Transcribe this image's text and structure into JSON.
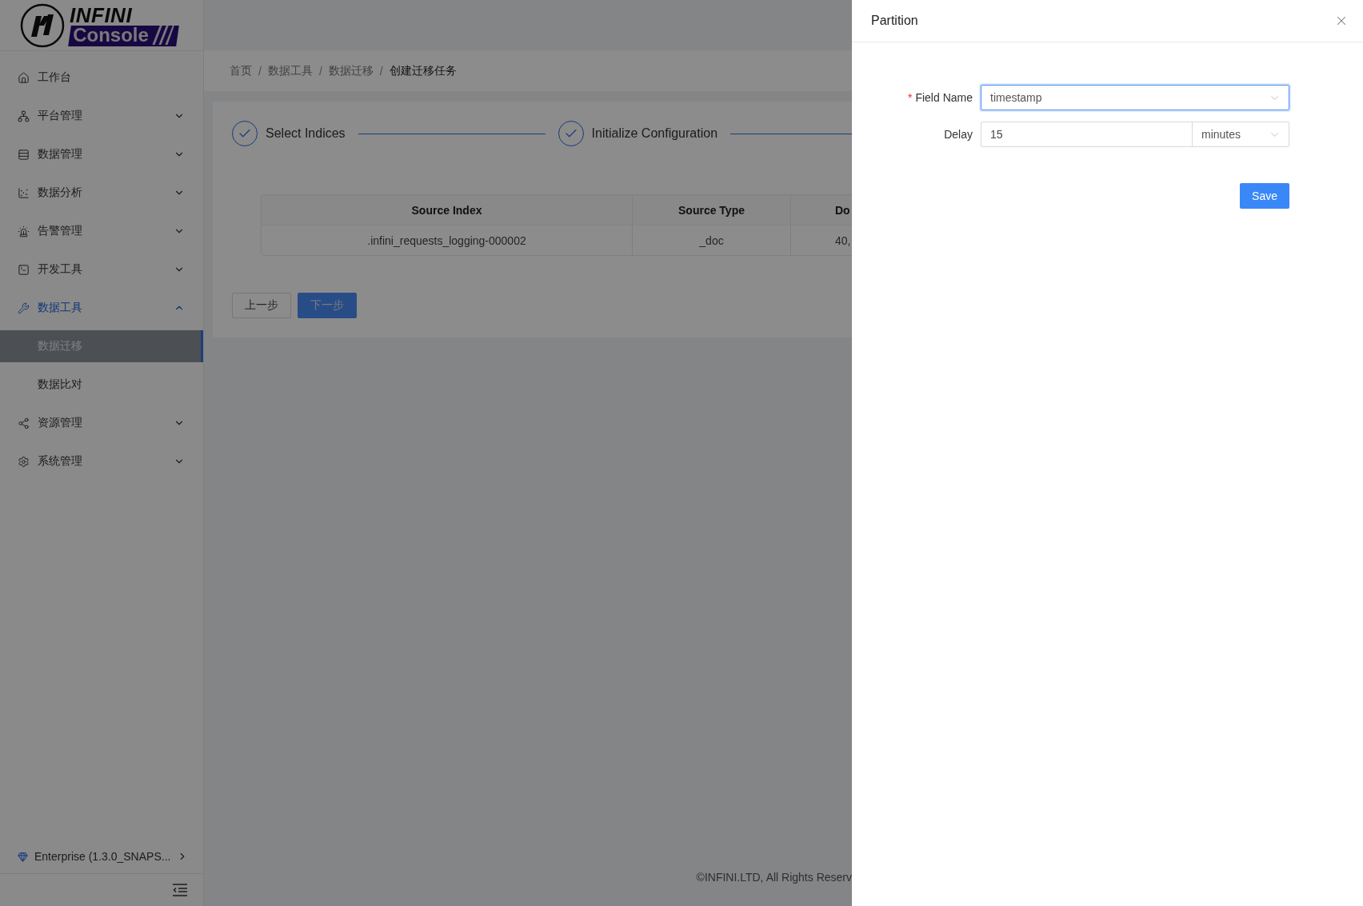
{
  "logo": {
    "line1": "INFINI",
    "line2": "Console"
  },
  "sidebar": {
    "items": [
      {
        "label": "工作台",
        "kind": "link",
        "selected": false
      },
      {
        "label": "平台管理",
        "kind": "group",
        "selected": false,
        "expanded": false
      },
      {
        "label": "数据管理",
        "kind": "group",
        "selected": false,
        "expanded": false
      },
      {
        "label": "数据分析",
        "kind": "group",
        "selected": false,
        "expanded": false
      },
      {
        "label": "告警管理",
        "kind": "group",
        "selected": false,
        "expanded": false
      },
      {
        "label": "开发工具",
        "kind": "group",
        "selected": false,
        "expanded": false
      },
      {
        "label": "数据工具",
        "kind": "group",
        "selected": true,
        "expanded": true,
        "children": [
          {
            "label": "数据迁移",
            "selected": true
          },
          {
            "label": "数据比对",
            "selected": false
          }
        ]
      },
      {
        "label": "资源管理",
        "kind": "group",
        "selected": false,
        "expanded": false
      },
      {
        "label": "系统管理",
        "kind": "group",
        "selected": false,
        "expanded": false
      }
    ],
    "edition": "Enterprise (1.3.0_SNAPS..."
  },
  "breadcrumb": {
    "separator": "/",
    "items": [
      "首页",
      "数据工具",
      "数据迁移",
      "创建迁移任务"
    ]
  },
  "steps": [
    {
      "title": "Select Indices",
      "done": true
    },
    {
      "title": "Initialize Configuration",
      "done": true
    }
  ],
  "table": {
    "columns": [
      "Source Index",
      "Source Type",
      "Do"
    ],
    "rows": [
      [
        ".infini_requests_logging-000002",
        "_doc",
        "40,"
      ]
    ]
  },
  "buttons": {
    "back": "上一步",
    "next": "下一步"
  },
  "footer": "©INFINI.LTD, All Rights Reserv",
  "drawer": {
    "title": "Partition",
    "fields": [
      {
        "label": "Field Name",
        "required_mark": "*",
        "kind": "select",
        "value": "timestamp",
        "focused": true
      },
      {
        "label": "Delay",
        "kind": "number-unit",
        "value": "15",
        "unit": "minutes",
        "focused": false
      }
    ],
    "save": "Save"
  }
}
